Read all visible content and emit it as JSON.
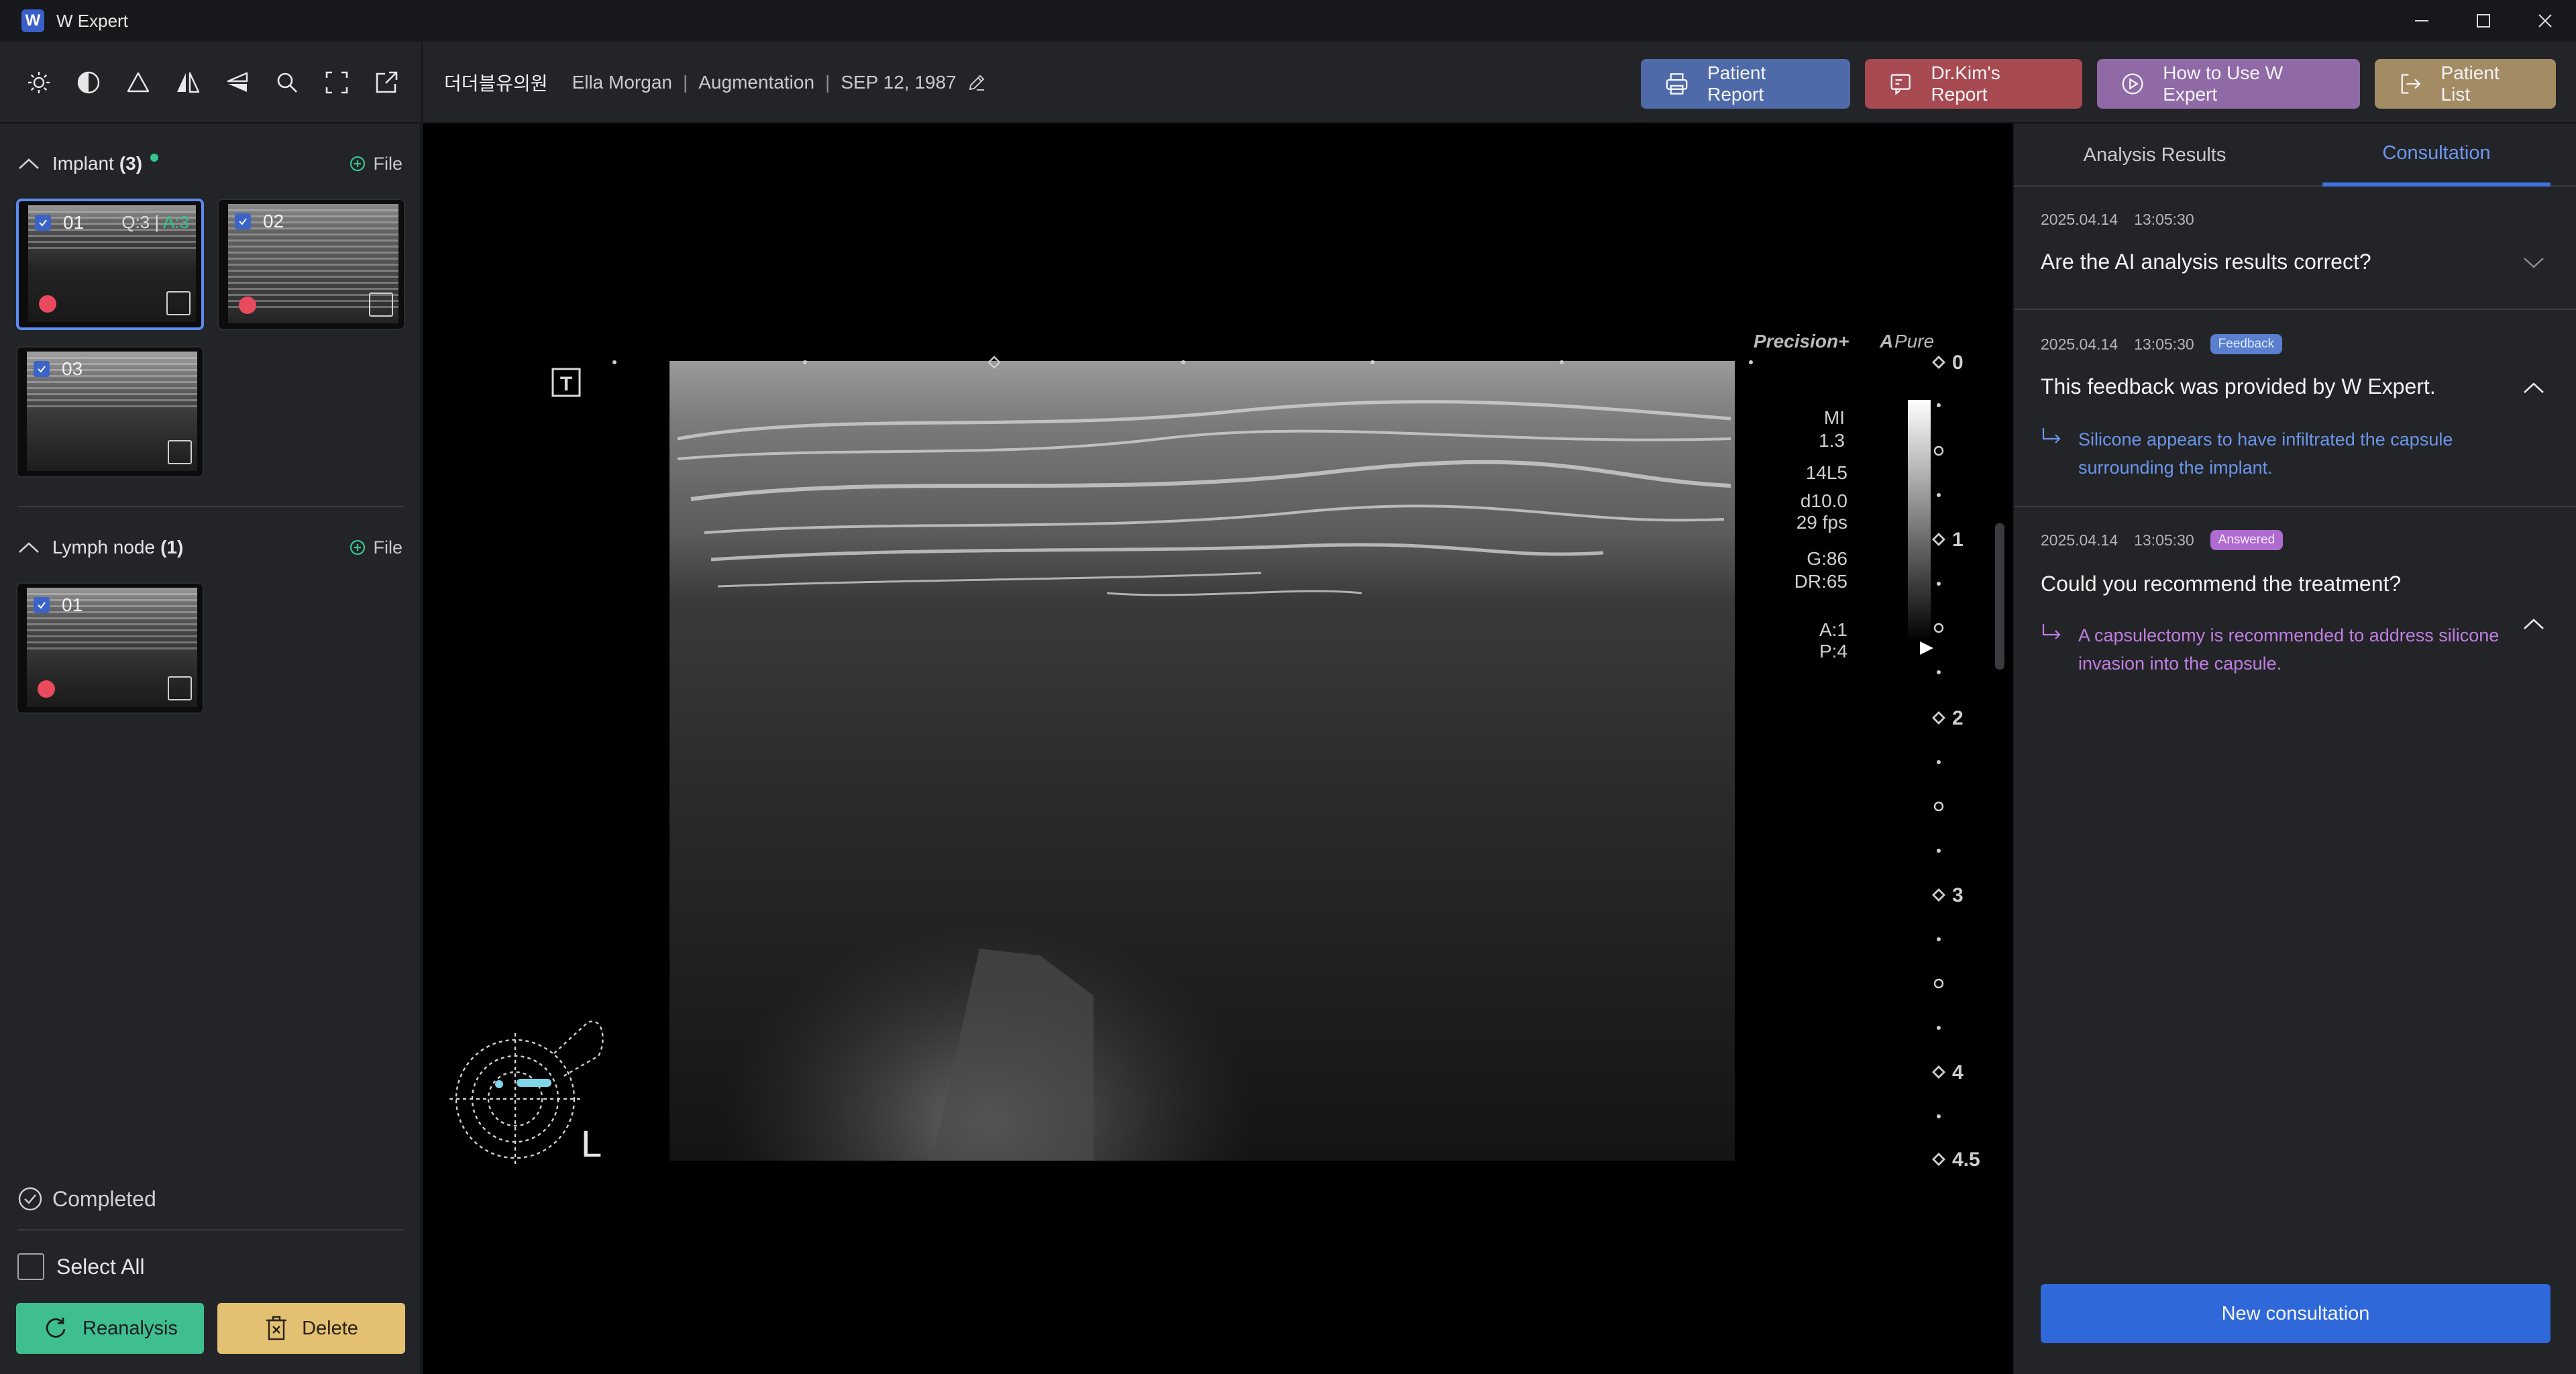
{
  "app": {
    "title": "W Expert",
    "logo_letter": "W"
  },
  "toolbar": {
    "tools": [
      "brightness-icon",
      "contrast-icon",
      "triangle-icon",
      "flip-horizontal-icon",
      "flip-vertical-icon",
      "zoom-icon",
      "fullscreen-icon",
      "export-icon"
    ],
    "clinic": "더더블유의원",
    "patient_name": "Ella Morgan",
    "procedure": "Augmentation",
    "birthdate": "SEP 12, 1987",
    "buttons": {
      "patient_report": "Patient Report",
      "dr_report": "Dr.Kim's Report",
      "how_to": "How to Use W Expert",
      "patient_list": "Patient List"
    }
  },
  "sidebar": {
    "implant": {
      "label": "Implant",
      "count": "(3)",
      "file_label": "File",
      "thumbs": [
        {
          "num": "01",
          "q": "Q:3",
          "a": "A:3"
        },
        {
          "num": "02"
        },
        {
          "num": "03"
        }
      ]
    },
    "lymph": {
      "label": "Lymph node",
      "count": "(1)",
      "file_label": "File",
      "thumbs": [
        {
          "num": "01"
        }
      ]
    },
    "status": "Completed",
    "select_all": "Select All",
    "reanalysis": "Reanalysis",
    "delete": "Delete"
  },
  "viewer": {
    "brand_precision": "Precision+",
    "brand_pure": "Pure",
    "t_marker": "T",
    "params": [
      "MI",
      "1.3",
      "14L5",
      "d10.0",
      "29 fps",
      "G:86",
      "DR:65",
      "A:1",
      "P:4"
    ],
    "depth_labels": [
      "0",
      "1",
      "2",
      "3",
      "4",
      "4.5"
    ],
    "side_label": "L"
  },
  "right": {
    "tabs": [
      "Analysis Results",
      "Consultation"
    ],
    "cards": [
      {
        "date": "2025.04.14",
        "time": "13:05:30",
        "question": "Are the AI analysis results correct?"
      },
      {
        "date": "2025.04.14",
        "time": "13:05:30",
        "badge": "Feedback",
        "question": "This feedback was provided by W Expert.",
        "answer": "Silicone appears to have infiltrated the capsule surrounding the implant."
      },
      {
        "date": "2025.04.14",
        "time": "13:05:30",
        "badge": "Answered",
        "question": "Could you recommend the treatment?",
        "answer": "A capsulectomy is recommended to address silicone invasion into the capsule."
      }
    ],
    "new_consultation": "New consultation"
  }
}
